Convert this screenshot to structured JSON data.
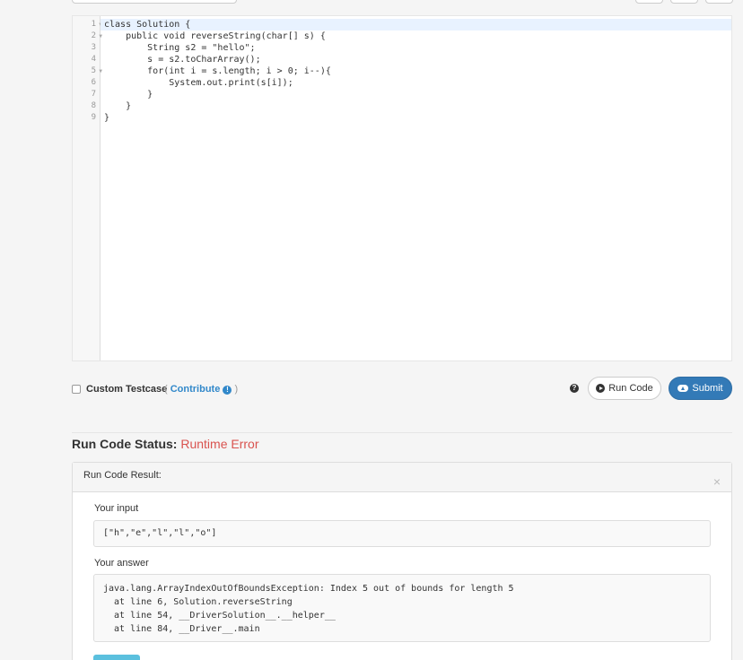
{
  "editor": {
    "lines": [
      {
        "n": "1",
        "fold": true
      },
      {
        "n": "2",
        "fold": true
      },
      {
        "n": "3",
        "fold": false
      },
      {
        "n": "4",
        "fold": false
      },
      {
        "n": "5",
        "fold": true
      },
      {
        "n": "6",
        "fold": false
      },
      {
        "n": "7",
        "fold": false
      },
      {
        "n": "8",
        "fold": false
      },
      {
        "n": "9",
        "fold": false
      }
    ],
    "code": [
      "class Solution {",
      "    public void reverseString(char[] s) {",
      "        String s2 = \"hello\";",
      "        s = s2.toCharArray();",
      "        for(int i = s.length; i > 0; i--){",
      "            System.out.print(s[i]);",
      "        }",
      "    }",
      "}"
    ]
  },
  "actions": {
    "custom_testcase_label": "Custom Testcase",
    "contribute_open": "( ",
    "contribute_label": "Contribute",
    "contribute_close": " )",
    "info_glyph": "!",
    "help_glyph": "?",
    "run_code_label": "Run Code",
    "submit_label": "Submit"
  },
  "status": {
    "label": "Run Code Status:",
    "value": "Runtime Error",
    "value_color": "#d9534f"
  },
  "result": {
    "title": "Run Code Result:",
    "close_glyph": "×",
    "input_label": "Your input",
    "input_value": "[\"h\",\"e\",\"l\",\"l\",\"o\"]",
    "answer_label": "Your answer",
    "answer_value": "java.lang.ArrayIndexOutOfBoundsException: Index 5 out of bounds for length 5\n  at line 6, Solution.reverseString\n  at line 54, __DriverSolution__.__helper__\n  at line 84, __Driver__.main"
  },
  "colors": {
    "accent": "#337ab7",
    "link": "#3188ca",
    "error": "#d9534f"
  }
}
